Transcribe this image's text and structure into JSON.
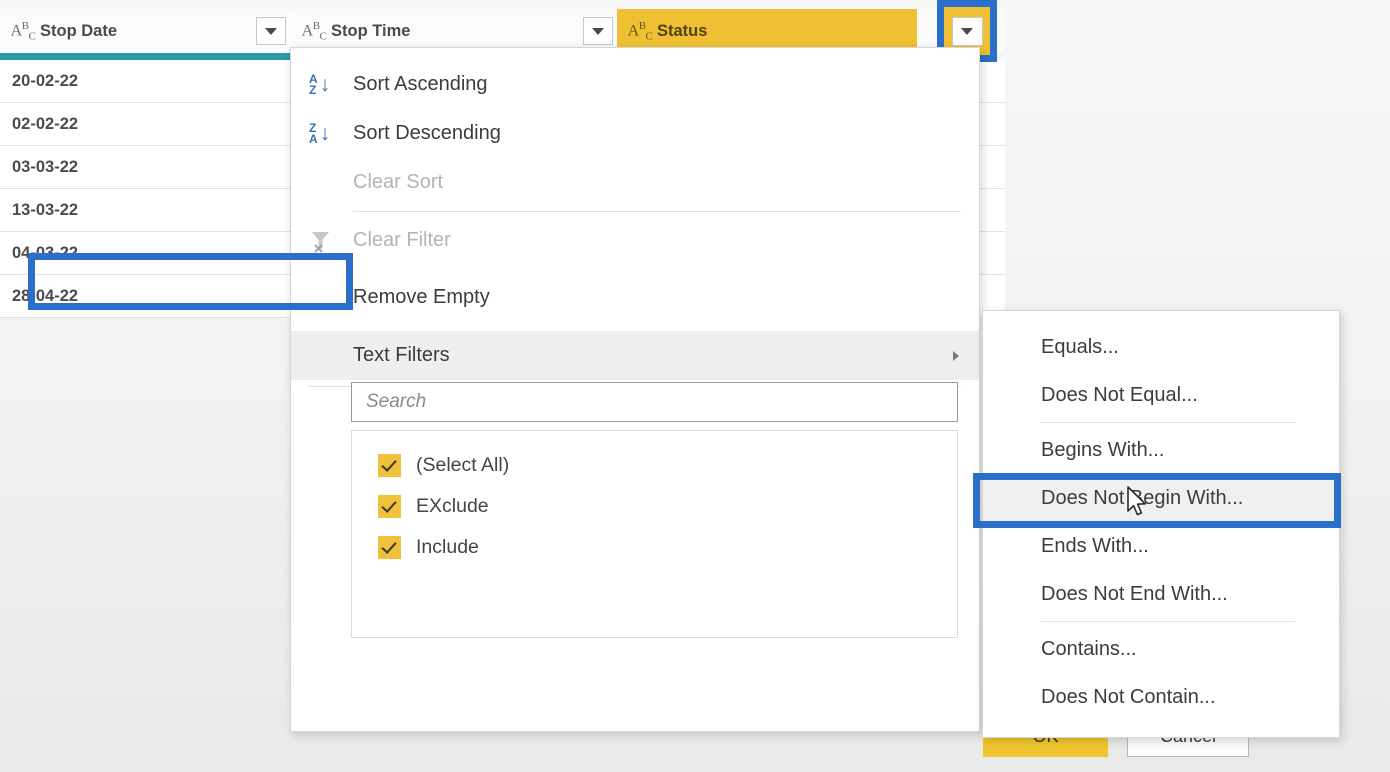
{
  "grid": {
    "columns": [
      {
        "type_icon": "abc-text-type-icon",
        "name": "Stop Date",
        "has_filter_button": true,
        "highlighted": false
      },
      {
        "type_icon": "abc-text-type-icon",
        "name": "Stop Time",
        "has_filter_button": true,
        "highlighted": false
      },
      {
        "type_icon": "abc-text-type-icon",
        "name": "Status",
        "has_filter_button": true,
        "highlighted": true
      }
    ],
    "rows": [
      {
        "stop_date": "20-02-22"
      },
      {
        "stop_date": "02-02-22"
      },
      {
        "stop_date": "03-03-22"
      },
      {
        "stop_date": "13-03-22"
      },
      {
        "stop_date": "04-03-22"
      },
      {
        "stop_date": "28-04-22"
      }
    ]
  },
  "filter_menu": {
    "items": [
      {
        "label": "Sort Ascending",
        "icon": "sort-ascending-icon",
        "disabled": false
      },
      {
        "label": "Sort Descending",
        "icon": "sort-descending-icon",
        "disabled": false
      },
      {
        "label": "Clear Sort",
        "icon": "none",
        "disabled": true
      },
      {
        "label": "Clear Filter",
        "icon": "clear-filter-funnel-icon",
        "disabled": true
      },
      {
        "label": "Remove Empty",
        "icon": "none",
        "disabled": false
      },
      {
        "label": "Text Filters",
        "icon": "none",
        "disabled": false,
        "has_submenu": true,
        "hovered": true
      }
    ],
    "search": {
      "placeholder": "Search",
      "value": ""
    },
    "checkboxes": [
      {
        "label": "(Select All)",
        "checked": true
      },
      {
        "label": "EXclude",
        "checked": true
      },
      {
        "label": "Include",
        "checked": true
      }
    ],
    "ok_label": "OK",
    "cancel_label": "Cancel"
  },
  "text_filters_submenu": {
    "items": [
      {
        "label": "Equals...",
        "selected": false
      },
      {
        "label": "Does Not Equal...",
        "selected": false
      },
      {
        "label": "Begins With...",
        "selected": false
      },
      {
        "label": "Does Not Begin With...",
        "selected": true
      },
      {
        "label": "Ends With...",
        "selected": false
      },
      {
        "label": "Does Not End With...",
        "selected": false
      },
      {
        "label": "Contains...",
        "selected": false
      },
      {
        "label": "Does Not Contain...",
        "selected": false
      }
    ]
  },
  "colors": {
    "accent_gold": "#efc033",
    "highlight_blue": "#2a6fc9",
    "teal_bar": "#2a9aa6",
    "checkbox_gold": "#f0c13a",
    "ok_button": "#efc62f"
  }
}
